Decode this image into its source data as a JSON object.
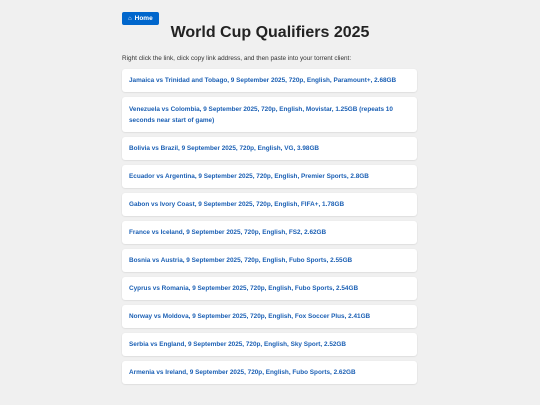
{
  "nav": {
    "home_label": "Home",
    "home_icon": "home-icon"
  },
  "header": {
    "title": "World Cup Qualifiers 2025"
  },
  "instructions": "Right click the link, click copy link address, and then paste into your torrent client:",
  "matches": [
    "Jamaica vs Trinidad and Tobago, 9 September 2025, 720p, English, Paramount+, 2.68GB",
    "Venezuela vs Colombia, 9 September 2025, 720p, English, Movistar, 1.25GB (repeats 10 seconds near start of game)",
    "Bolivia vs Brazil, 9 September 2025, 720p, English, VG, 3.98GB",
    "Ecuador vs Argentina, 9 September 2025, 720p, English, Premier Sports, 2.8GB",
    "Gabon vs Ivory Coast, 9 September 2025, 720p, English, FIFA+, 1.78GB",
    "France vs Iceland, 9 September 2025, 720p, English, FS2, 2.62GB",
    "Bosnia vs Austria, 9 September 2025, 720p, English, Fubo Sports, 2.55GB",
    "Cyprus vs Romania, 9 September 2025, 720p, English, Fubo Sports, 2.54GB",
    "Norway vs Moldova, 9 September 2025, 720p, English, Fox Soccer Plus, 2.41GB",
    "Serbia vs England, 9 September 2025, 720p, English, Sky Sport, 2.52GB",
    "Armenia vs Ireland, 9 September 2025, 720p, English, Fubo Sports, 2.62GB"
  ]
}
